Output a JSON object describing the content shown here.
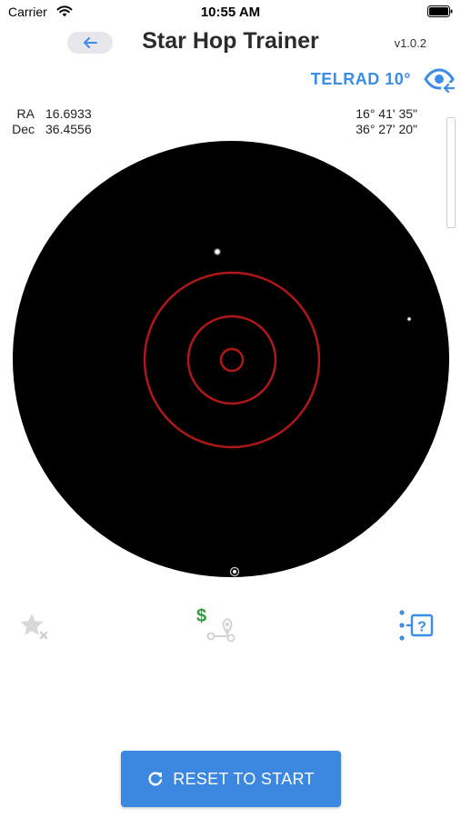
{
  "status_bar": {
    "carrier": "Carrier",
    "time": "10:55 AM"
  },
  "header": {
    "title": "Star Hop Trainer",
    "version": "v1.0.2",
    "back_icon": "arrow-left-icon"
  },
  "telrad": {
    "label": "TELRAD 10°",
    "eye_icon": "eye-toggle-icon"
  },
  "coordinates": {
    "ra_label": "RA",
    "ra_value": "16.6933",
    "dec_label": "Dec",
    "dec_value": "36.4556",
    "ra_hms": "16° 41' 35\"",
    "dec_dms": "36° 27' 20\""
  },
  "sky": {
    "background_color": "#000000",
    "reticle_color": "#b01818"
  },
  "toolbar": {
    "favorite_icon": "star-remove-icon",
    "hop_icon": "paid-route-icon",
    "hop_badge": "$",
    "help_icon": "help-list-icon"
  },
  "actions": {
    "reset_label": "RESET TO START",
    "reset_icon": "refresh-icon"
  },
  "colors": {
    "accent": "#3a8ee6",
    "button": "#3c87e0",
    "badge_green": "#2f9e3a"
  }
}
